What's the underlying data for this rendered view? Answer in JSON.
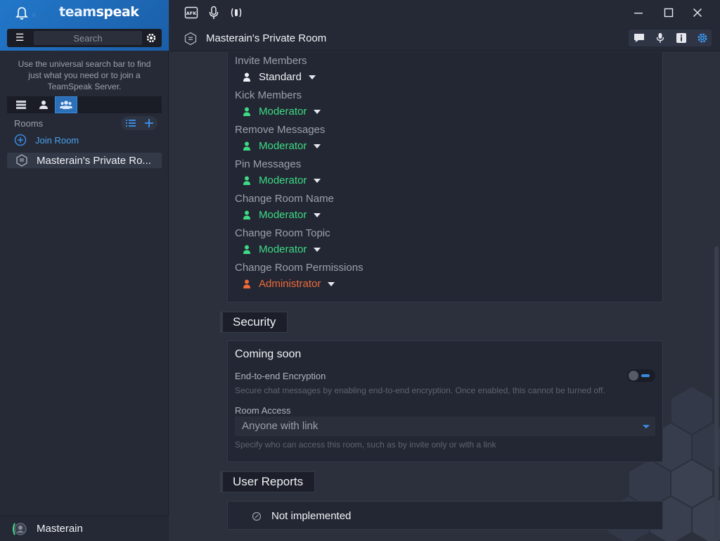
{
  "app": {
    "logo_text": "teamspeak",
    "search_placeholder": "Search",
    "hint": "Use the universal search bar to find just what you need or to join a TeamSpeak Server.",
    "accent": "#3a8ae0"
  },
  "topbar": {
    "afk_label": "AFK"
  },
  "sidebar": {
    "rooms_label": "Rooms",
    "join_room": "Join Room",
    "room_name": "Masterain's Private Ro...",
    "user_name": "Masterain"
  },
  "room": {
    "title": "Masterain's Private Room"
  },
  "permissions": [
    {
      "label": "Invite Members",
      "role": "Standard",
      "color": "#f0f2f6"
    },
    {
      "label": "Kick Members",
      "role": "Moderator",
      "color": "#3ddc84"
    },
    {
      "label": "Remove Messages",
      "role": "Moderator",
      "color": "#3ddc84"
    },
    {
      "label": "Pin Messages",
      "role": "Moderator",
      "color": "#3ddc84"
    },
    {
      "label": "Change Room Name",
      "role": "Moderator",
      "color": "#3ddc84"
    },
    {
      "label": "Change Room Topic",
      "role": "Moderator",
      "color": "#3ddc84"
    },
    {
      "label": "Change Room Permissions",
      "role": "Administrator",
      "color": "#f06a3a"
    }
  ],
  "security": {
    "tab_label": "Security",
    "title": "Coming soon",
    "e2e_label": "End-to-end Encryption",
    "e2e_desc": "Secure chat messages by enabling end-to-end encryption. Once enabled, this cannot be turned off.",
    "access_label": "Room Access",
    "access_value": "Anyone with link",
    "access_desc": "Specify who can access this room, such as by invite only or with a link"
  },
  "reports": {
    "tab_label": "User Reports",
    "text": "Not implemented"
  }
}
